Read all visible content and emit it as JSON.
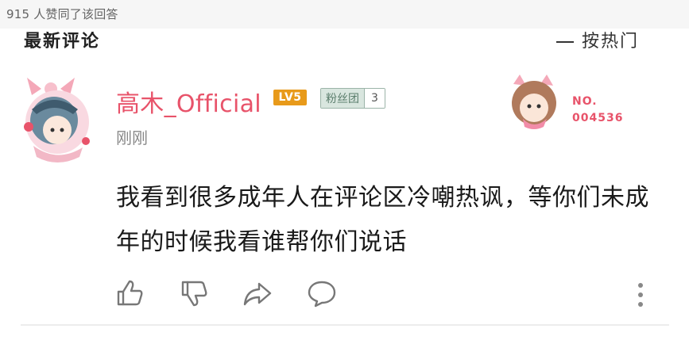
{
  "votes_text": "915 人赞同了该回答",
  "header": {
    "left_partial": "最新评论",
    "right_partial": "按热门"
  },
  "comment": {
    "username": "高木_Official",
    "level_badge": "LV5",
    "fan_badge_name": "粉丝团",
    "fan_badge_level": "3",
    "time": "刚刚",
    "card_no_label": "NO.",
    "card_no_value": "004536",
    "text": "我看到很多成年人在评论区冷嘲热讽，等你们未成年的时候我看谁帮你们说话"
  },
  "actions": {
    "icons": [
      "thumbs-up-icon",
      "thumbs-down-icon",
      "share-icon",
      "comment-icon",
      "more-icon"
    ]
  },
  "colors": {
    "username": "#e8536a",
    "level_badge": "#e89a1a",
    "fan_badge_bg": "#d9e6df",
    "text": "#1a1a1a",
    "meta": "#888888"
  }
}
